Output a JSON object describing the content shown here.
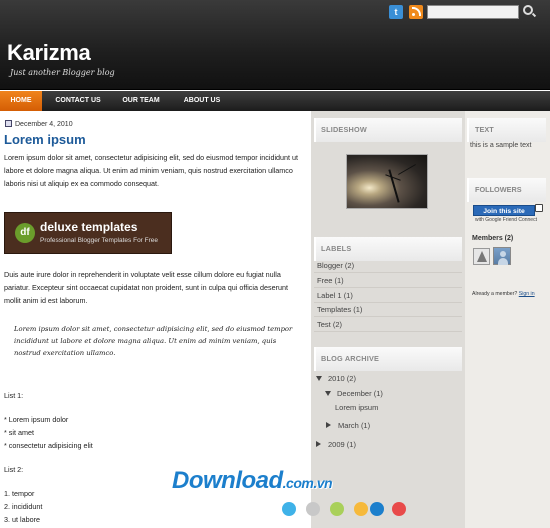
{
  "header": {
    "site_title": "Karizma",
    "tagline": "Just another Blogger blog",
    "search_placeholder": "",
    "twitter_icon_text": "t"
  },
  "nav": {
    "items": [
      "HOME",
      "CONTACT US",
      "OUR TEAM",
      "ABOUT US"
    ],
    "active_color": "#e8720f"
  },
  "post": {
    "date": "December 4, 2010",
    "title": "Lorem ipsum",
    "para1": "Lorem ipsum dolor sit amet, consectetur adipisicing elit, sed do eiusmod tempor incididunt ut labore et dolore magna aliqua. Ut enim ad minim veniam, quis nostrud exercitation ullamco laboris nisi ut aliquip ex ea commodo consequat.",
    "banner": {
      "logo_text": "df",
      "title": "deluxe templates",
      "subtitle": "Professional Blogger Templates For Free"
    },
    "para2": "Duis aute irure dolor in reprehenderit in voluptate velit esse cillum dolore eu fugiat nulla pariatur. Excepteur sint occaecat cupidatat non proident, sunt in culpa qui officia deserunt mollit anim id est laborum.",
    "quote": "Lorem ipsum dolor sit amet, consectetur adipisicing elit, sed do eiusmod tempor incididunt ut labore et dolore magna aliqua. Ut enim ad minim veniam, quis nostrud exercitation ullamco.",
    "list1_title": "List 1:",
    "list1": [
      "* Lorem ipsum dolor",
      "* sit amet",
      "* consectetur adipisicing elit"
    ],
    "list2_title": "List 2:",
    "list2": [
      "1. tempor",
      "2. incididunt",
      "3. ut labore"
    ]
  },
  "sidebar_mid": {
    "slideshow_title": "SLIDESHOW",
    "labels_title": "LABELS",
    "labels": [
      "Blogger (2)",
      "Free (1)",
      "Label 1 (1)",
      "Templates (1)",
      "Test (2)"
    ],
    "archive_title": "BLOG ARCHIVE",
    "archive": {
      "year_2010": "2010",
      "year_2010_count": "(2)",
      "december": "December",
      "december_count": "(1)",
      "post": "Lorem ipsum",
      "march": "March",
      "march_count": "(1)",
      "year_2009": "2009",
      "year_2009_count": "(1)"
    }
  },
  "sidebar_right": {
    "text_title": "TEXT",
    "text_body": "this is a sample text",
    "followers_title": "FOLLOWERS",
    "join_label": "Join this site",
    "gfc_text": "with Google Friend Connect",
    "members": "Members (2)",
    "already_member": "Already a member?",
    "signin": "Sign in"
  },
  "watermark": {
    "text": "Download",
    "suffix": ".com.vn",
    "dot_colors": [
      "#3fb2e8",
      "#c8c8c8",
      "#a9d05a",
      "#f6b93b",
      "#1c7fcc",
      "#e84a4a"
    ]
  }
}
